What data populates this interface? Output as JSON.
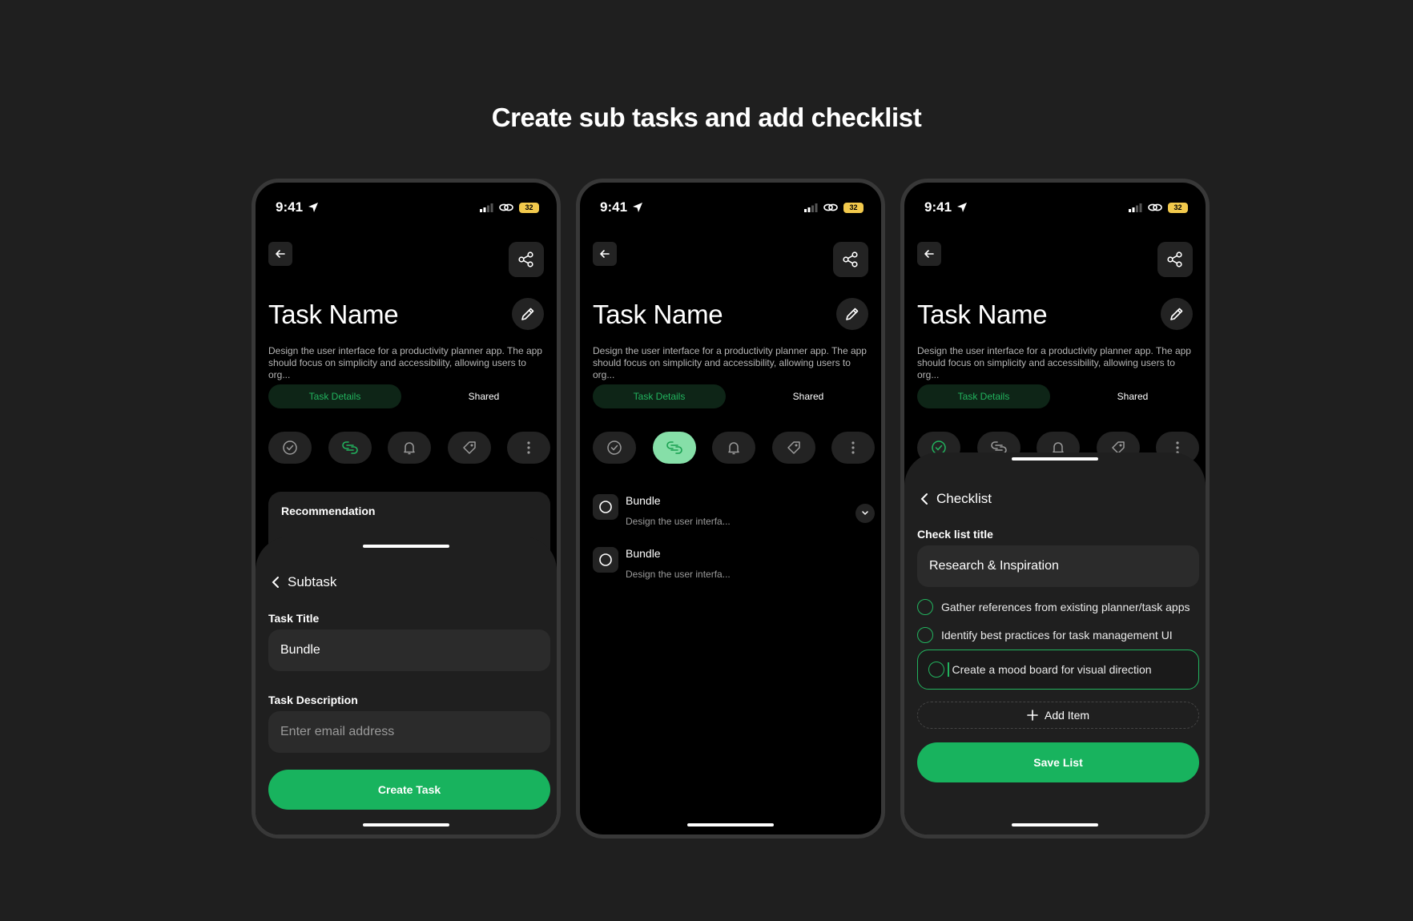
{
  "headline": "Create sub tasks and add checklist",
  "colors": {
    "accent": "#18b35e",
    "accent_text": "#22b35e",
    "selected_icon_bg": "#86dfa8",
    "background": "#1f1f1f",
    "screen": "#000000"
  },
  "status": {
    "time": "9:41",
    "battery": "32"
  },
  "task": {
    "name": "Task Name",
    "description": "Design the user interface for a productivity planner app. The app should focus on simplicity and accessibility, allowing users to org...",
    "tabs": {
      "details": "Task Details",
      "shared": "Shared"
    }
  },
  "action_icons": [
    "check-circle-icon",
    "link-icon",
    "bell-icon",
    "tag-icon",
    "more-vertical-icon"
  ],
  "screen1": {
    "recommendation_title": "Recommendation",
    "sheet_title": "Subtask",
    "title_label": "Task Title",
    "title_value": "Bundle",
    "description_label": "Task Description",
    "description_placeholder": "Enter email address",
    "submit_label": "Create Task"
  },
  "screen2": {
    "subtasks": [
      {
        "title": "Bundle",
        "desc": "Design the user interfa..."
      },
      {
        "title": "Bundle",
        "desc": "Design the user interfa..."
      }
    ]
  },
  "screen3": {
    "sheet_title": "Checklist",
    "list_title_label": "Check list title",
    "list_title_value": "Research & Inspiration",
    "items": [
      "Gather references from existing planner/task apps",
      "Identify best practices for task management UI"
    ],
    "editing_item": "Create a mood board for visual direction",
    "add_item_label": "Add Item",
    "save_label": "Save List"
  }
}
